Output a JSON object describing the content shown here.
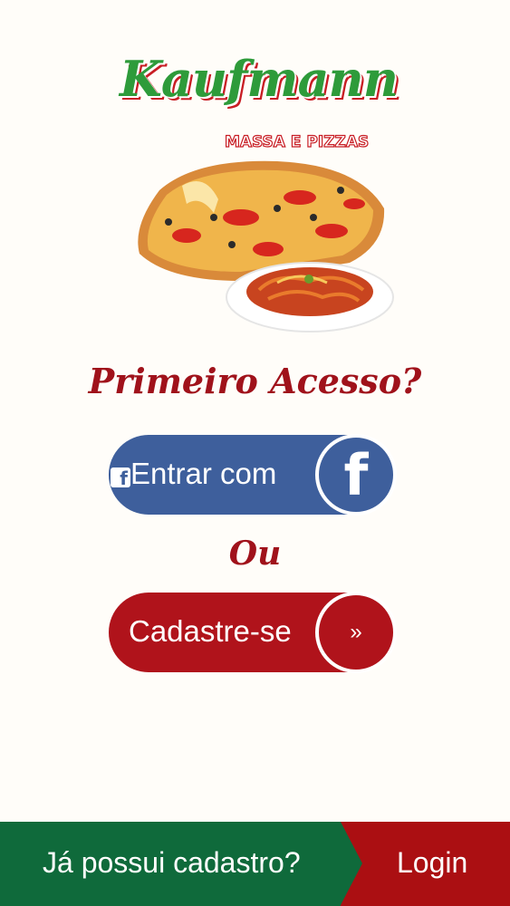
{
  "logo": {
    "title": "Kaufmann",
    "subtitle": "MASSA E PIZZAS"
  },
  "headline": "Primeiro Acesso?",
  "facebook_button": {
    "label": "Entrar com",
    "icon": "facebook-icon"
  },
  "separator": "Ou",
  "register_button": {
    "label": "Cadastre-se",
    "arrow": "»"
  },
  "footer": {
    "question": "Já possui cadastro?",
    "login_label": "Login"
  },
  "colors": {
    "brand_green": "#0f6a3b",
    "brand_red": "#ab0f12",
    "facebook_blue": "#3e5f9c",
    "title_red": "#a0121b"
  }
}
